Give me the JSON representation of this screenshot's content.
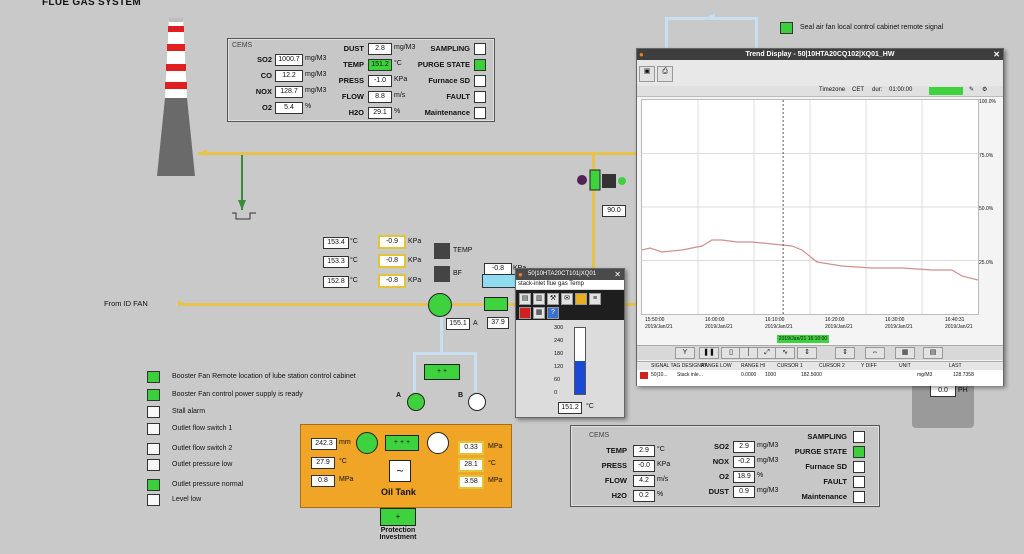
{
  "title": "FLUE GAS SYSTEM",
  "cems_top": {
    "heading": "CEMS",
    "rows": [
      {
        "label": "SO2",
        "value": "1000.7",
        "unit": "mg/M3"
      },
      {
        "label": "CO",
        "value": "12.2",
        "unit": "mg/M3"
      },
      {
        "label": "NOX",
        "value": "128.7",
        "unit": "mg/M3"
      },
      {
        "label": "O2",
        "value": "5.4",
        "unit": "%"
      }
    ],
    "rows2": [
      {
        "label": "DUST",
        "value": "2.8",
        "unit": "mg/M3"
      },
      {
        "label": "TEMP",
        "value": "151.2",
        "unit": "°C"
      },
      {
        "label": "PRESS",
        "value": "-1.0",
        "unit": "KPa"
      },
      {
        "label": "FLOW",
        "value": "8.8",
        "unit": "m/s"
      },
      {
        "label": "H2O",
        "value": "29.1",
        "unit": "%"
      }
    ],
    "flags": [
      "SAMPLING",
      "PURGE STATE",
      "Furnace SD",
      "FAULT",
      "Maintenance"
    ]
  },
  "seal_signal": "Seal air fan local control cabinet remote signal",
  "from_id_fan": "From ID FAN",
  "readings": {
    "t1": "153.4",
    "t2": "153.3",
    "t3": "152.8",
    "unit_c": "°C",
    "p1": "-0.9",
    "p2": "-0.8",
    "p3": "-0.8",
    "unit_kpa": "KPa",
    "temp_label": "TEMP",
    "bf_label": "BF",
    "top_val": "-0.8",
    "top_unit": "KPa",
    "v155": "155.1",
    "vA": "A",
    "v37": "37.9",
    "v90": "90.0"
  },
  "status_list": [
    {
      "label": "Booster Fan Remote location of lube station control cabinet",
      "on": true
    },
    {
      "label": "Booster Fan control power supply is ready",
      "on": true
    },
    {
      "label": "Stall alarm",
      "on": false
    },
    {
      "label": "Outlet flow switch 1",
      "on": false
    },
    {
      "label": "Outlet flow switch 2",
      "on": false
    },
    {
      "label": "Outlet pressure low",
      "on": false
    },
    {
      "label": "Outlet pressure normal",
      "on": true
    },
    {
      "label": "Level low",
      "on": false
    }
  ],
  "pump_labels": {
    "a": "A",
    "b": "B"
  },
  "oil_tank": {
    "title": "Oil Tank",
    "v1": "242.3",
    "u1": "mm",
    "v2": "27.9",
    "u2": "°C",
    "v3": "0.8",
    "u3": "MPa",
    "v4": "0.33",
    "u4": "MPa",
    "v5": "28.1",
    "u5": "°C",
    "v6": "3.58",
    "u6": "MPa"
  },
  "protection": "Protection Investment",
  "cems_bottom": {
    "heading": "CEMS",
    "left": [
      {
        "label": "TEMP",
        "value": "2.9",
        "unit": "°C"
      },
      {
        "label": "PRESS",
        "value": "-0.0",
        "unit": "KPa"
      },
      {
        "label": "FLOW",
        "value": "4.2",
        "unit": "m/s"
      },
      {
        "label": "H2O",
        "value": "0.2",
        "unit": "%"
      }
    ],
    "mid": [
      {
        "label": "SO2",
        "value": "2.9",
        "unit": "mg/M3"
      },
      {
        "label": "NOX",
        "value": "-0.2",
        "unit": "mg/M3"
      },
      {
        "label": "O2",
        "value": "18.9",
        "unit": "%"
      },
      {
        "label": "DUST",
        "value": "0.9",
        "unit": "mg/M3"
      }
    ],
    "flags": [
      "SAMPLING",
      "PURGE STATE",
      "Furnace SD",
      "FAULT",
      "Maintenance"
    ]
  },
  "ph": {
    "value": "0.0",
    "unit": "PH"
  },
  "faceplate": {
    "title": "50|10HTA20CT101|XQ01",
    "subtitle": "stack-inlet flue gas Temp",
    "scale": [
      "300",
      "240",
      "180",
      "120",
      "60",
      "0"
    ],
    "value": "151.2",
    "unit": "°C",
    "fill_fraction": 0.5
  },
  "trend": {
    "title": "Trend Display - 50|10HTA20CQ102|XQ01_HW",
    "timezone_label": "Timezone",
    "timezone": "CET",
    "dur_label": "dur:",
    "dur": "01:00:00",
    "y_ticks": [
      "100.0%",
      "75.0%",
      "50.0%",
      "25.0%"
    ],
    "x_ticks": [
      "15:50:00",
      "16:00:00",
      "16:10:00",
      "16:20:00",
      "16:30:00",
      "16:40:31"
    ],
    "x_dates": [
      "2019/Jan/21",
      "2019/Jan/21",
      "2019/Jan/21",
      "2019/Jan/21",
      "2019/Jan/21",
      "2019/Jan/21"
    ],
    "cursor_time": "2019/Jan/21 16:10:00",
    "columns": [
      "SIGNAL TAG DESIGNAT.",
      "RANGE LOW",
      "RANGE HI",
      "CURSOR 1",
      "CURSOR 2",
      "Y DIFF",
      "UNIT",
      "LAST"
    ],
    "row": [
      "50|10...",
      "Stack inle...",
      "0.0000",
      "1000",
      "182.5000",
      "",
      "",
      "mg/M3",
      "128.7358"
    ]
  }
}
